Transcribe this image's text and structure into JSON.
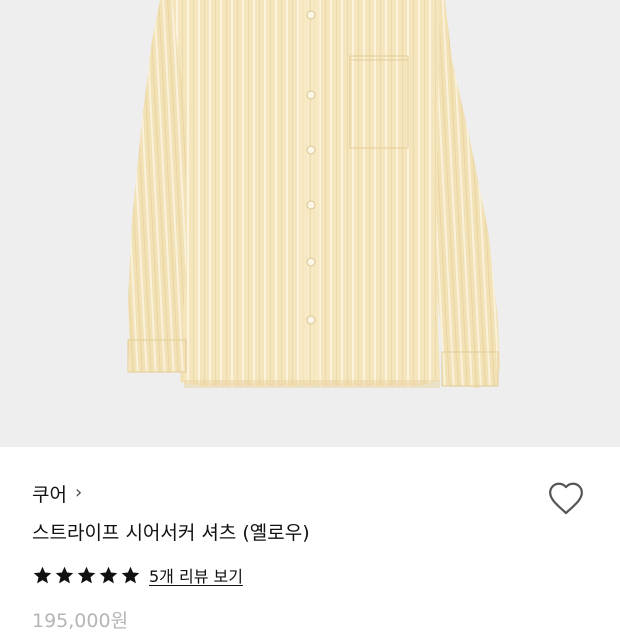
{
  "product": {
    "brand": "쿠어",
    "brand_chevron": "›",
    "title": "스트라이프 시어서커 셔츠 (옐로우)",
    "rating": 5,
    "rating_max": 5,
    "review_link": "5개 리뷰 보기",
    "price": "195,000원",
    "image_bg": "#eeeeee",
    "shirt_color": "#f4e5bd",
    "stripe_color": "#fbf3de"
  },
  "icons": {
    "wishlist": "heart-outline-icon",
    "star": "star-filled-icon",
    "brand_link": "chevron-right-icon"
  }
}
